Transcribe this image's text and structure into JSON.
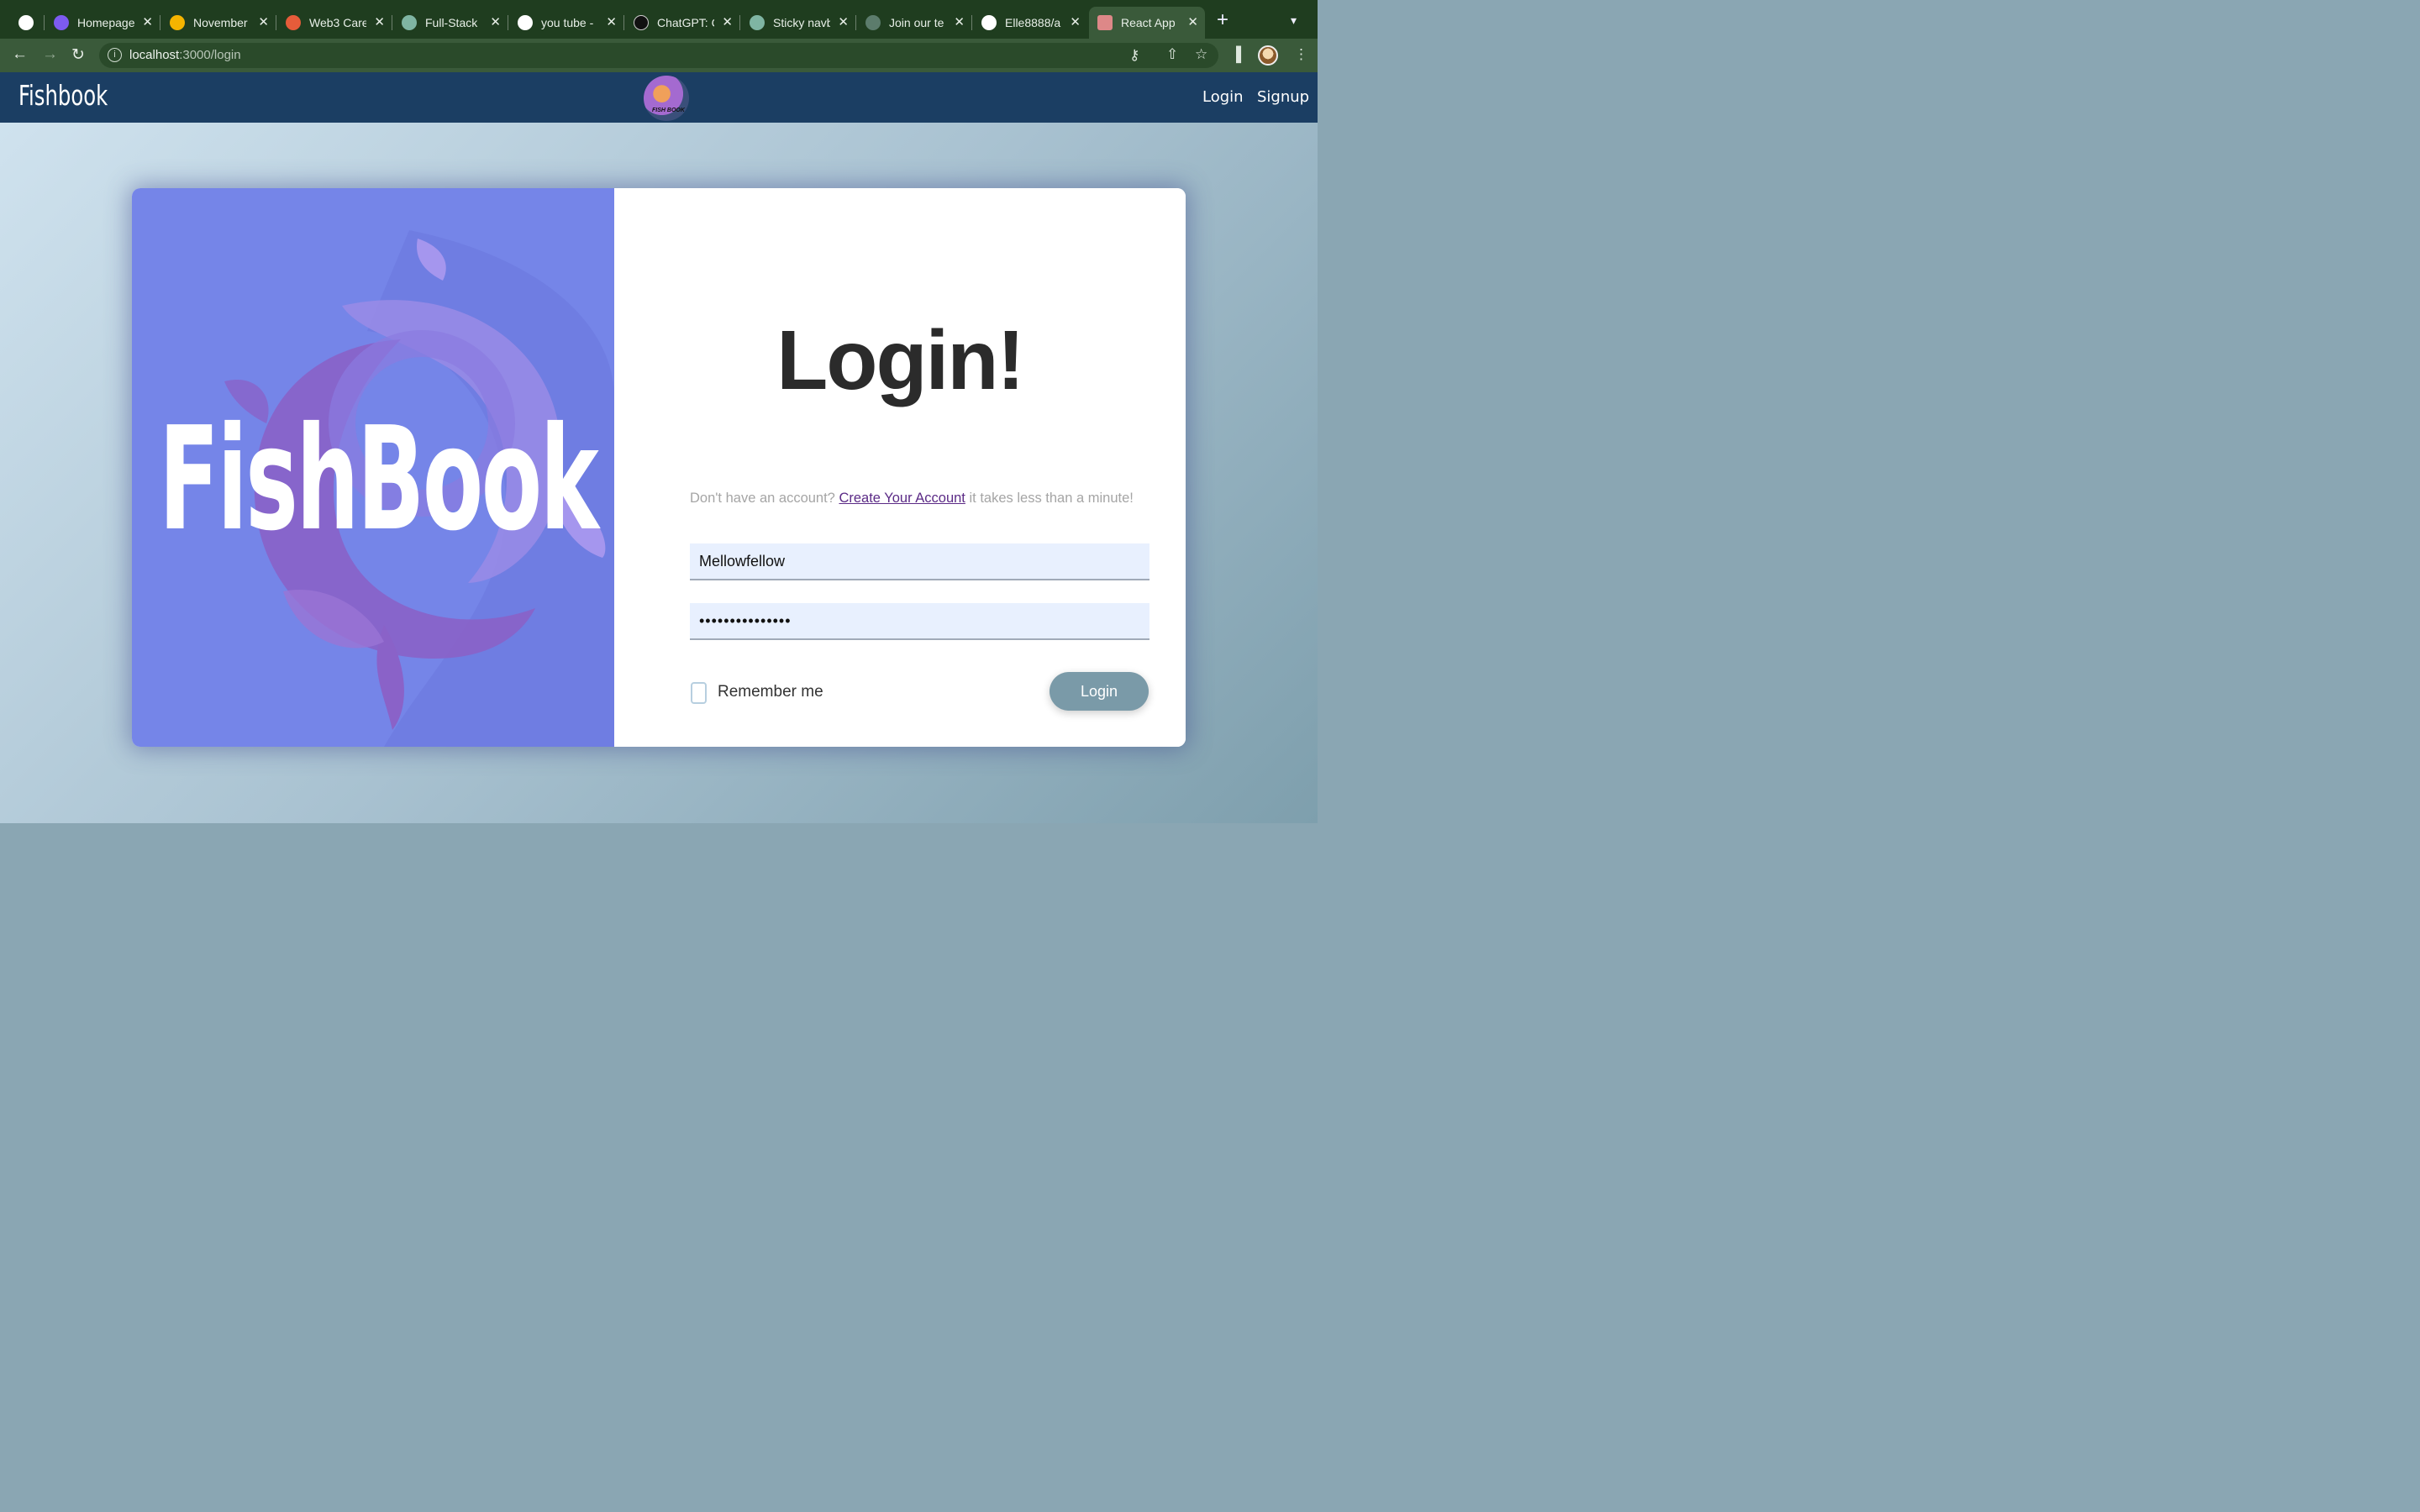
{
  "browser": {
    "tabs": [
      {
        "title": "",
        "icon": "github-icon",
        "color": "#ffffff"
      },
      {
        "title": "Homepage",
        "icon": "canva-icon",
        "color": "#7d5bf0"
      },
      {
        "title": "November",
        "icon": "google-drive-icon",
        "color": "#f4b400"
      },
      {
        "title": "Web3 Care",
        "icon": "web3-icon",
        "color": "#e65c3a"
      },
      {
        "title": "Full-Stack",
        "icon": "openai-icon",
        "color": "#7fb5a3"
      },
      {
        "title": "you tube -",
        "icon": "google-icon",
        "color": "#ffffff"
      },
      {
        "title": "ChatGPT: C",
        "icon": "chatgpt-icon",
        "color": "#111111"
      },
      {
        "title": "Sticky navb",
        "icon": "openai-icon",
        "color": "#7fb5a3"
      },
      {
        "title": "Join our te",
        "icon": "community-icon",
        "color": "#5c7c6c"
      },
      {
        "title": "Elle8888/a",
        "icon": "github-icon",
        "color": "#ffffff"
      },
      {
        "title": "React App",
        "icon": "react-app-icon",
        "color": "#d88"
      }
    ],
    "url_host": "localhost",
    "url_path": ":3000/login"
  },
  "header": {
    "brand": "Fishbook",
    "logo_text": "FISH BOOK",
    "links": {
      "login": "Login",
      "signup": "Signup"
    }
  },
  "hero": {
    "brand": "FishBook"
  },
  "form": {
    "title": "Login!",
    "prompt_before": "Don't have an account? ",
    "prompt_link": "Create Your Account",
    "prompt_after": " it takes less than a minute!",
    "username_value": "Mellowfellow",
    "password_value": "•••••••••••••••",
    "remember_label": "Remember me",
    "submit_label": "Login"
  }
}
